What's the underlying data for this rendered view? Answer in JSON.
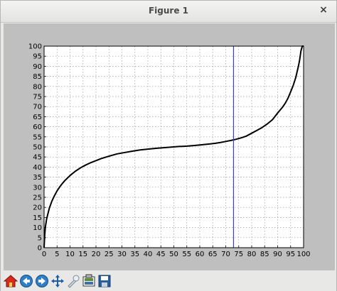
{
  "window": {
    "title": "Figure 1",
    "close_glyph": "×"
  },
  "toolbar": {
    "buttons": [
      {
        "icon": "home-icon"
      },
      {
        "icon": "back-arrow-icon"
      },
      {
        "icon": "forward-arrow-icon"
      },
      {
        "icon": "pan-icon"
      },
      {
        "icon": "zoom-icon"
      },
      {
        "icon": "configure-subplots-icon"
      },
      {
        "icon": "save-icon"
      }
    ]
  },
  "chart_data": {
    "type": "line",
    "title": "",
    "xlabel": "",
    "ylabel": "",
    "xlim": [
      0,
      100
    ],
    "ylim": [
      0,
      100
    ],
    "xticks": [
      0,
      5,
      10,
      15,
      20,
      25,
      30,
      35,
      40,
      45,
      50,
      55,
      60,
      65,
      70,
      75,
      80,
      85,
      90,
      95,
      100
    ],
    "yticks": [
      0,
      5,
      10,
      15,
      20,
      25,
      30,
      35,
      40,
      45,
      50,
      55,
      60,
      65,
      70,
      75,
      80,
      85,
      90,
      95,
      100
    ],
    "grid": true,
    "series": [
      {
        "color": "#000000",
        "x": [
          0,
          0.25,
          0.5,
          1,
          2,
          3,
          4,
          5,
          6,
          7,
          8,
          10,
          12,
          14,
          16,
          18,
          20,
          22,
          25,
          28,
          31,
          34,
          37,
          40,
          43,
          46,
          49,
          52,
          55,
          58,
          61,
          64,
          66,
          68,
          70,
          72,
          74,
          76,
          78,
          80,
          82,
          84,
          86,
          88,
          90,
          92,
          93,
          94,
          95,
          96,
          97,
          98,
          98.5,
          99,
          99.5,
          99.75,
          100
        ],
        "y": [
          0,
          6.3,
          10.3,
          14.4,
          19.5,
          23.1,
          25.8,
          28.2,
          30.1,
          31.8,
          33.3,
          35.8,
          37.9,
          39.6,
          41.0,
          42.2,
          43.2,
          44.2,
          45.4,
          46.5,
          47.2,
          47.9,
          48.5,
          48.9,
          49.3,
          49.6,
          49.9,
          50.2,
          50.4,
          50.7,
          51.1,
          51.5,
          51.8,
          52.2,
          52.7,
          53.2,
          53.8,
          54.5,
          55.4,
          56.8,
          58.2,
          59.6,
          61.4,
          63.5,
          66.8,
          69.9,
          71.8,
          74.2,
          77.3,
          80.5,
          84.5,
          90.0,
          93.3,
          97.7,
          100,
          100,
          100
        ]
      }
    ],
    "vline": {
      "x": 73,
      "color": "#3c3cc8"
    }
  }
}
